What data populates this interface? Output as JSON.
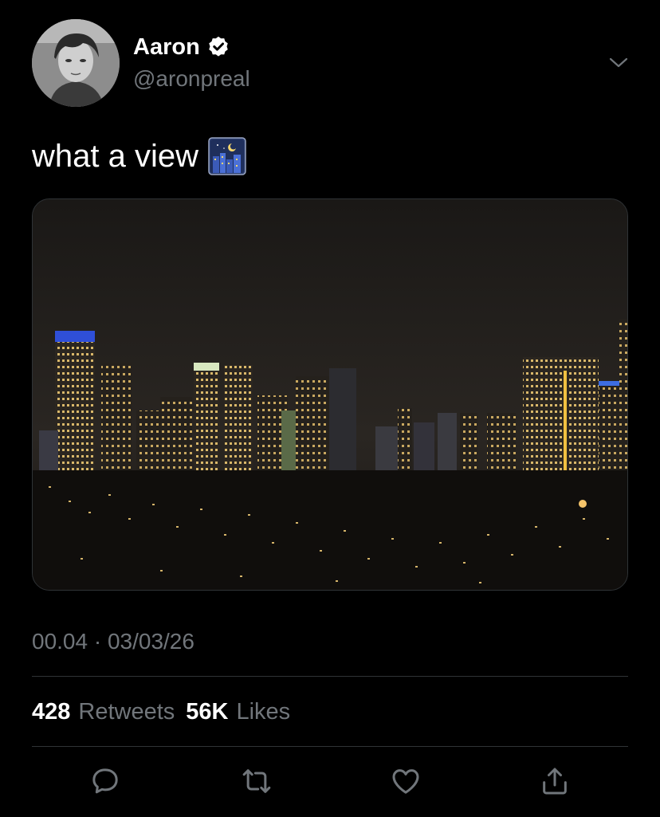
{
  "author": {
    "display_name": "Aaron",
    "handle": "@aronpreal",
    "verified": true,
    "avatar_icon": "profile-photo"
  },
  "tweet": {
    "text": "what a view",
    "emoji": "night-city-emoji",
    "media_alt_icon": "night-city-skyline-photo"
  },
  "meta": {
    "timestamp": "00.04 · 03/03/26"
  },
  "stats": {
    "retweets_count": "428",
    "retweets_label": "Retweets",
    "likes_count": "56K",
    "likes_label": "Likes"
  },
  "actions": [
    {
      "name": "reply",
      "icon": "speech-bubble-icon"
    },
    {
      "name": "retweet",
      "icon": "retweet-icon"
    },
    {
      "name": "like",
      "icon": "heart-icon"
    },
    {
      "name": "share",
      "icon": "share-icon"
    }
  ],
  "colors": {
    "background": "#000000",
    "primary_text": "#ffffff",
    "secondary_text": "#71767b",
    "divider": "#2f3336"
  }
}
